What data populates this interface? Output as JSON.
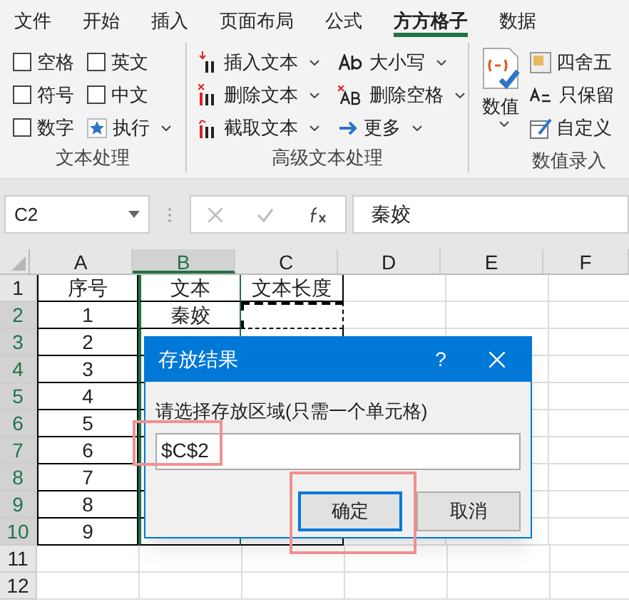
{
  "tabs": [
    {
      "label": "文件",
      "selected": false
    },
    {
      "label": "开始",
      "selected": false
    },
    {
      "label": "插入",
      "selected": false
    },
    {
      "label": "页面布局",
      "selected": false
    },
    {
      "label": "公式",
      "selected": false
    },
    {
      "label": "方方格子",
      "selected": true
    },
    {
      "label": "数据",
      "selected": false
    }
  ],
  "ribbon": {
    "text_group": {
      "checkboxes": [
        {
          "label": "空格",
          "checked": false
        },
        {
          "label": "英文",
          "checked": false
        },
        {
          "label": "符号",
          "checked": false
        },
        {
          "label": "中文",
          "checked": false
        },
        {
          "label": "数字",
          "checked": false
        }
      ],
      "run": "执行",
      "label": "文本处理"
    },
    "advanced_group": {
      "items": [
        {
          "label": "插入文本",
          "kind": "insert"
        },
        {
          "label": "大小写",
          "kind": "case"
        },
        {
          "label": "删除文本",
          "kind": "delete"
        },
        {
          "label": "删除空格",
          "kind": "space"
        },
        {
          "label": "截取文本",
          "kind": "cut"
        },
        {
          "label": "更多",
          "kind": "more"
        }
      ],
      "label": "高级文本处理"
    },
    "number_group": {
      "big_button": "数值",
      "items": [
        {
          "label": "四舍五",
          "kind": "round"
        },
        {
          "label": "只保留",
          "kind": "keep"
        },
        {
          "label": "自定义",
          "kind": "custom"
        }
      ],
      "label": "数值录入"
    }
  },
  "formula_bar": {
    "name_box": "C2",
    "formula": "秦姣"
  },
  "grid": {
    "columns": [
      {
        "label": "A",
        "selected": false
      },
      {
        "label": "B",
        "selected": true
      },
      {
        "label": "C",
        "selected": false
      },
      {
        "label": "D",
        "selected": false
      },
      {
        "label": "E",
        "selected": false
      },
      {
        "label": "F",
        "selected": false
      }
    ],
    "rows": [
      {
        "label": "1",
        "selected": false,
        "cells": [
          {
            "text": "序号"
          },
          {
            "text": "文本"
          },
          {
            "text": "文本长度"
          }
        ]
      },
      {
        "label": "2",
        "selected": true,
        "cells": [
          {
            "text": "1"
          },
          {
            "text": "秦姣"
          },
          {
            "marquee": true
          }
        ]
      },
      {
        "label": "3",
        "selected": true,
        "cells": [
          {
            "text": "2"
          }
        ]
      },
      {
        "label": "4",
        "selected": true,
        "cells": [
          {
            "text": "3"
          }
        ]
      },
      {
        "label": "5",
        "selected": true,
        "cells": [
          {
            "text": "4"
          }
        ]
      },
      {
        "label": "6",
        "selected": true,
        "cells": [
          {
            "text": "5"
          }
        ]
      },
      {
        "label": "7",
        "selected": true,
        "cells": [
          {
            "text": "6"
          }
        ]
      },
      {
        "label": "8",
        "selected": true,
        "cells": [
          {
            "text": "7"
          }
        ]
      },
      {
        "label": "9",
        "selected": true,
        "cells": [
          {
            "text": "8"
          }
        ]
      },
      {
        "label": "10",
        "selected": true,
        "cells": [
          {
            "text": "9"
          }
        ]
      },
      {
        "label": "11",
        "selected": false
      },
      {
        "label": "12",
        "selected": false
      }
    ]
  },
  "dialog": {
    "title": "存放结果",
    "help": "?",
    "prompt": "请选择存放区域(只需一个单元格)",
    "value": "$C$2",
    "buttons": [
      {
        "label": "确定",
        "selected": true
      },
      {
        "label": "取消",
        "selected": false
      }
    ]
  }
}
